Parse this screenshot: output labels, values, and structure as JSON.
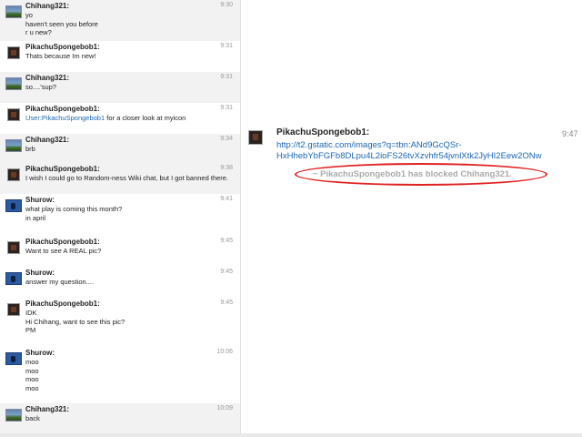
{
  "messages": [
    {
      "user": "Chihang321:",
      "time": "9:30",
      "avatar": "scenery",
      "alt": true,
      "lines": [
        "yo",
        "haven't seen you before",
        "r u new?"
      ]
    },
    {
      "user": "PikachuSpongebob1:",
      "time": "9:31",
      "avatar": "dark",
      "alt": false,
      "lines": [
        "Thats because Im new!"
      ]
    },
    {
      "user": "Chihang321:",
      "time": "9:31",
      "avatar": "scenery",
      "alt": true,
      "lines": [
        "so....'sup?"
      ]
    },
    {
      "user": "PikachuSpongebob1:",
      "time": "9:31",
      "avatar": "dark",
      "alt": false,
      "link": "User:PikachuSpongebob1",
      "lines": [
        " for a closer look at myicon"
      ]
    },
    {
      "user": "Chihang321:",
      "time": "9:34",
      "avatar": "scenery",
      "alt": true,
      "lines": [
        "brb"
      ]
    },
    {
      "user": "PikachuSpongebob1:",
      "time": "9:38",
      "avatar": "dark",
      "alt": true,
      "lines": [
        "I wish I could go to Random-ness Wiki chat, but I got banned there."
      ]
    },
    {
      "user": "Shurow:",
      "time": "9:41",
      "avatar": "blue",
      "alt": false,
      "lines": [
        "what play is coming this month?",
        "in april"
      ]
    },
    {
      "user": "PikachuSpongebob1:",
      "time": "9:45",
      "avatar": "dark",
      "alt": false,
      "lines": [
        "Want to see A REAL pic?"
      ]
    },
    {
      "user": "Shurow:",
      "time": "9:45",
      "avatar": "blue",
      "alt": false,
      "lines": [
        "answer my question...."
      ]
    },
    {
      "user": "PikachuSpongebob1:",
      "time": "9:45",
      "avatar": "dark",
      "alt": false,
      "lines": [
        "IDK",
        "Hi Chihang, want to see this pic?",
        "PM"
      ]
    },
    {
      "user": "Shurow:",
      "time": "10:06",
      "avatar": "blue",
      "alt": false,
      "lines": [
        "moo",
        "moo",
        "moo",
        "moo"
      ]
    },
    {
      "user": "Chihang321:",
      "time": "10:09",
      "avatar": "scenery",
      "alt": true,
      "lines": [
        "back"
      ]
    }
  ],
  "right": {
    "user": "PikachuSpongebob1:",
    "time": "9:47",
    "link_line1": "http://t2.gstatic.com/images?q=tbn:ANd9GcQSr-",
    "link_line2": "HxHhebYbFGFb8DLpu4L2ioFS26tvXzvhfr54jvnlXtk2JyHI2Eew2ONw",
    "status": "~ PikachuSpongebob1 has blocked Chihang321.",
    "annotation_color": "#e02020"
  }
}
